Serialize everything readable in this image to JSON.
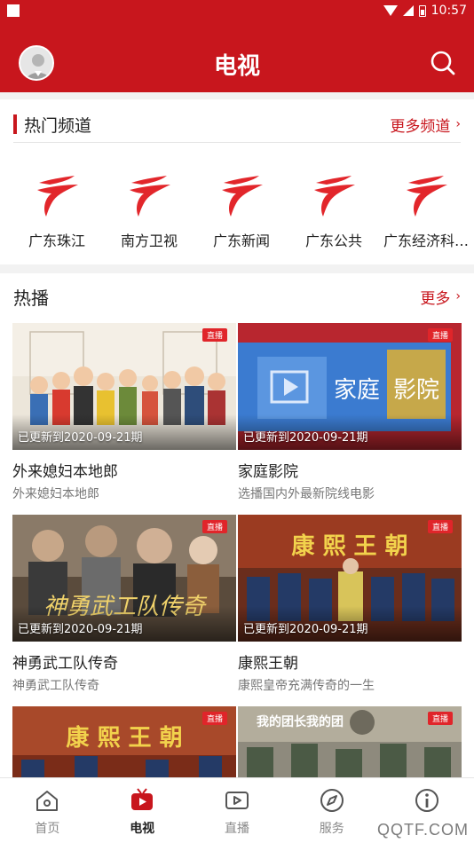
{
  "status_bar": {
    "time": "10:57"
  },
  "header": {
    "title": "电视"
  },
  "hot_channels": {
    "title": "热门频道",
    "more_label": "更多频道",
    "channels": [
      {
        "name": "广东珠江"
      },
      {
        "name": "南方卫视"
      },
      {
        "name": "广东新闻"
      },
      {
        "name": "广东公共"
      },
      {
        "name": "广东经济科…"
      }
    ]
  },
  "hot_broadcasts": {
    "title": "热播",
    "more_label": "更多",
    "items": [
      {
        "title": "外来媳妇本地郎",
        "subtitle": "外来媳妇本地郎",
        "update": "已更新到2020-09-21期",
        "live": "直播"
      },
      {
        "title": "家庭影院",
        "subtitle": "选播国内外最新院线电影",
        "update": "已更新到2020-09-21期",
        "live": "直播",
        "thumb_text_1": "家庭",
        "thumb_text_2": "影院"
      },
      {
        "title": "神勇武工队传奇",
        "subtitle": "神勇武工队传奇",
        "update": "已更新到2020-09-21期",
        "live": "直播",
        "thumb_text": "神勇武工队传奇"
      },
      {
        "title": "康熙王朝",
        "subtitle": "康熙皇帝充满传奇的一生",
        "update": "已更新到2020-09-21期",
        "live": "直播",
        "thumb_text": "康 熙 王 朝"
      },
      {
        "title": "",
        "subtitle": "",
        "update": "",
        "live": "直播",
        "thumb_text": "康 熙 王 朝"
      },
      {
        "title": "",
        "subtitle": "",
        "update": "",
        "live": "直播",
        "thumb_text": "我的团长我的团"
      }
    ]
  },
  "bottom_nav": {
    "items": [
      {
        "label": "首页",
        "icon": "home-icon"
      },
      {
        "label": "电视",
        "icon": "tv-icon"
      },
      {
        "label": "直播",
        "icon": "live-icon"
      },
      {
        "label": "服务",
        "icon": "compass-icon"
      },
      {
        "label": "",
        "icon": "info-icon"
      }
    ]
  },
  "watermark": "QQTF.COM",
  "colors": {
    "brand_red": "#c8161d",
    "text": "#222222",
    "muted": "#777777"
  }
}
